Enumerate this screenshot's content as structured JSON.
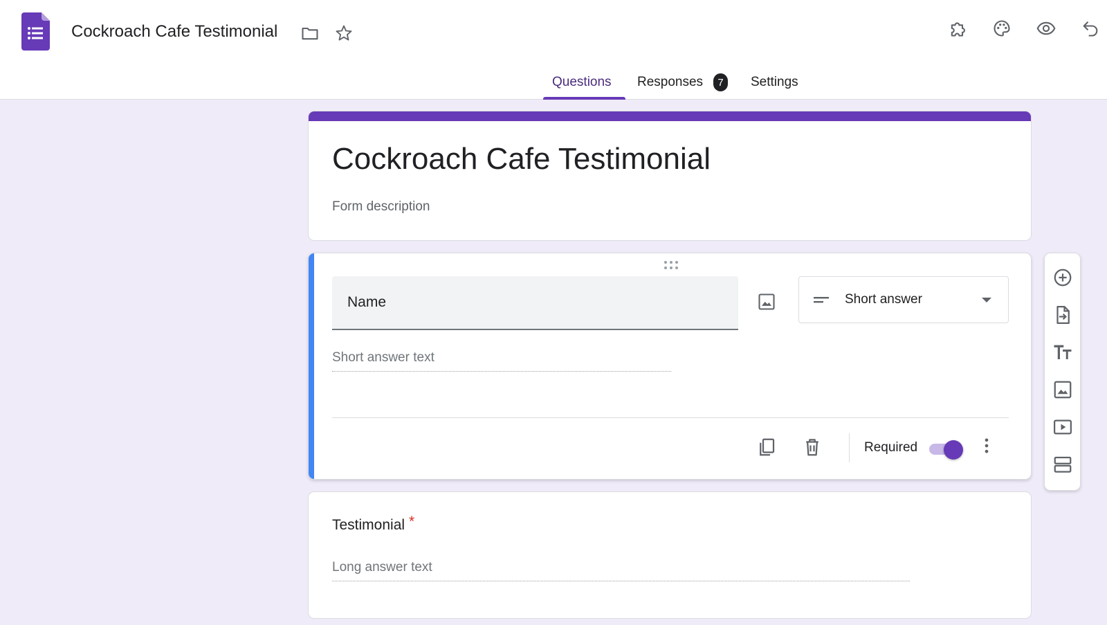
{
  "header": {
    "doc_title": "Cockroach Cafe Testimonial",
    "icons": [
      "forms-logo-icon",
      "folder-icon",
      "star-icon",
      "puzzle-icon",
      "palette-icon",
      "eye-icon",
      "undo-icon"
    ]
  },
  "tabs": [
    {
      "label": "Questions",
      "active": true
    },
    {
      "label": "Responses",
      "badge": "7"
    },
    {
      "label": "Settings"
    }
  ],
  "form": {
    "title": "Cockroach Cafe Testimonial",
    "description_placeholder": "Form description"
  },
  "questions": [
    {
      "title": "Name",
      "type": "Short answer",
      "answer_placeholder": "Short answer text",
      "required_label": "Required",
      "required": true
    },
    {
      "title": "Testimonial",
      "required_mark": "*",
      "answer_placeholder": "Long answer text"
    }
  ],
  "toolbar": {
    "icons": [
      "add-question-icon",
      "import-questions-icon",
      "add-title-icon",
      "add-image-icon",
      "add-video-icon",
      "add-section-icon"
    ]
  },
  "colors": {
    "accent": "#673ab7",
    "background": "#f0ebf8",
    "active_card": "#4285f4",
    "required": "#d93025"
  }
}
